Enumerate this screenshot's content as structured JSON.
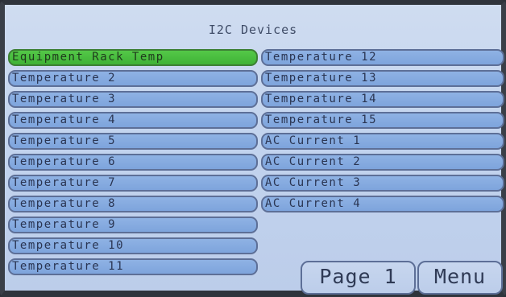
{
  "title": "I2C Devices",
  "left_column": [
    {
      "label": "Equipment Rack Temp",
      "selected": true
    },
    {
      "label": "Temperature 2"
    },
    {
      "label": "Temperature 3"
    },
    {
      "label": "Temperature 4"
    },
    {
      "label": "Temperature 5"
    },
    {
      "label": "Temperature 6"
    },
    {
      "label": "Temperature 7"
    },
    {
      "label": "Temperature 8"
    },
    {
      "label": "Temperature 9"
    },
    {
      "label": "Temperature 10"
    },
    {
      "label": "Temperature 11"
    }
  ],
  "right_column": [
    {
      "label": "Temperature 12"
    },
    {
      "label": "Temperature 13"
    },
    {
      "label": "Temperature 14"
    },
    {
      "label": "Temperature 15"
    },
    {
      "label": "AC Current 1"
    },
    {
      "label": "AC Current 2"
    },
    {
      "label": "AC Current 3"
    },
    {
      "label": "AC Current 4"
    }
  ],
  "footer": {
    "page_label": "Page 1",
    "menu_label": "Menu"
  },
  "colors": {
    "selected": "#4cc040",
    "button": "#86aae0",
    "background": "#c3d4ee"
  }
}
